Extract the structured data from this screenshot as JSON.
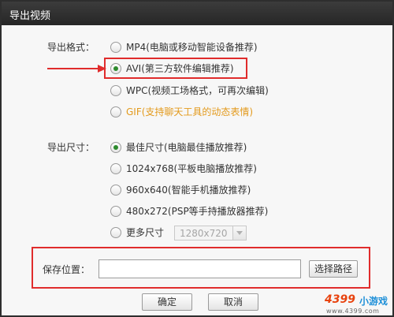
{
  "window": {
    "title": "导出视频"
  },
  "format": {
    "label": "导出格式：",
    "selected": "AVI",
    "options": [
      {
        "text": "MP4(电脑或移动智能设备推荐)",
        "checked": false
      },
      {
        "text": "AVI(第三方软件编辑推荐)",
        "checked": true
      },
      {
        "text": "WPC(视频工场格式，可再次编辑)",
        "checked": false
      },
      {
        "text": "GIF(支持聊天工具的动态表情)",
        "checked": false,
        "color": "#e39a1c"
      }
    ]
  },
  "size": {
    "label": "导出尺寸：",
    "options": [
      {
        "text": "最佳尺寸(电脑最佳播放推荐)",
        "checked": true
      },
      {
        "text": "1024x768(平板电脑播放推荐)",
        "checked": false
      },
      {
        "text": "960x640(智能手机播放推荐)",
        "checked": false
      },
      {
        "text": "480x272(PSP等手持播放器推荐)",
        "checked": false
      },
      {
        "text": "更多尺寸",
        "checked": false
      }
    ],
    "more_select_value": "1280x720"
  },
  "save": {
    "label": "保存位置：",
    "path_value": "",
    "browse_label": "选择路径"
  },
  "footer": {
    "ok_label": "确定",
    "cancel_label": "取消"
  },
  "watermark": {
    "brand": "4399",
    "name": "小游戏",
    "url": "www.4399.com"
  },
  "colors": {
    "highlight": "#e02c2c",
    "radio_dot": "#2d8a2d",
    "gif_text": "#e39a1c",
    "titlebar": "#2e2e2e"
  }
}
